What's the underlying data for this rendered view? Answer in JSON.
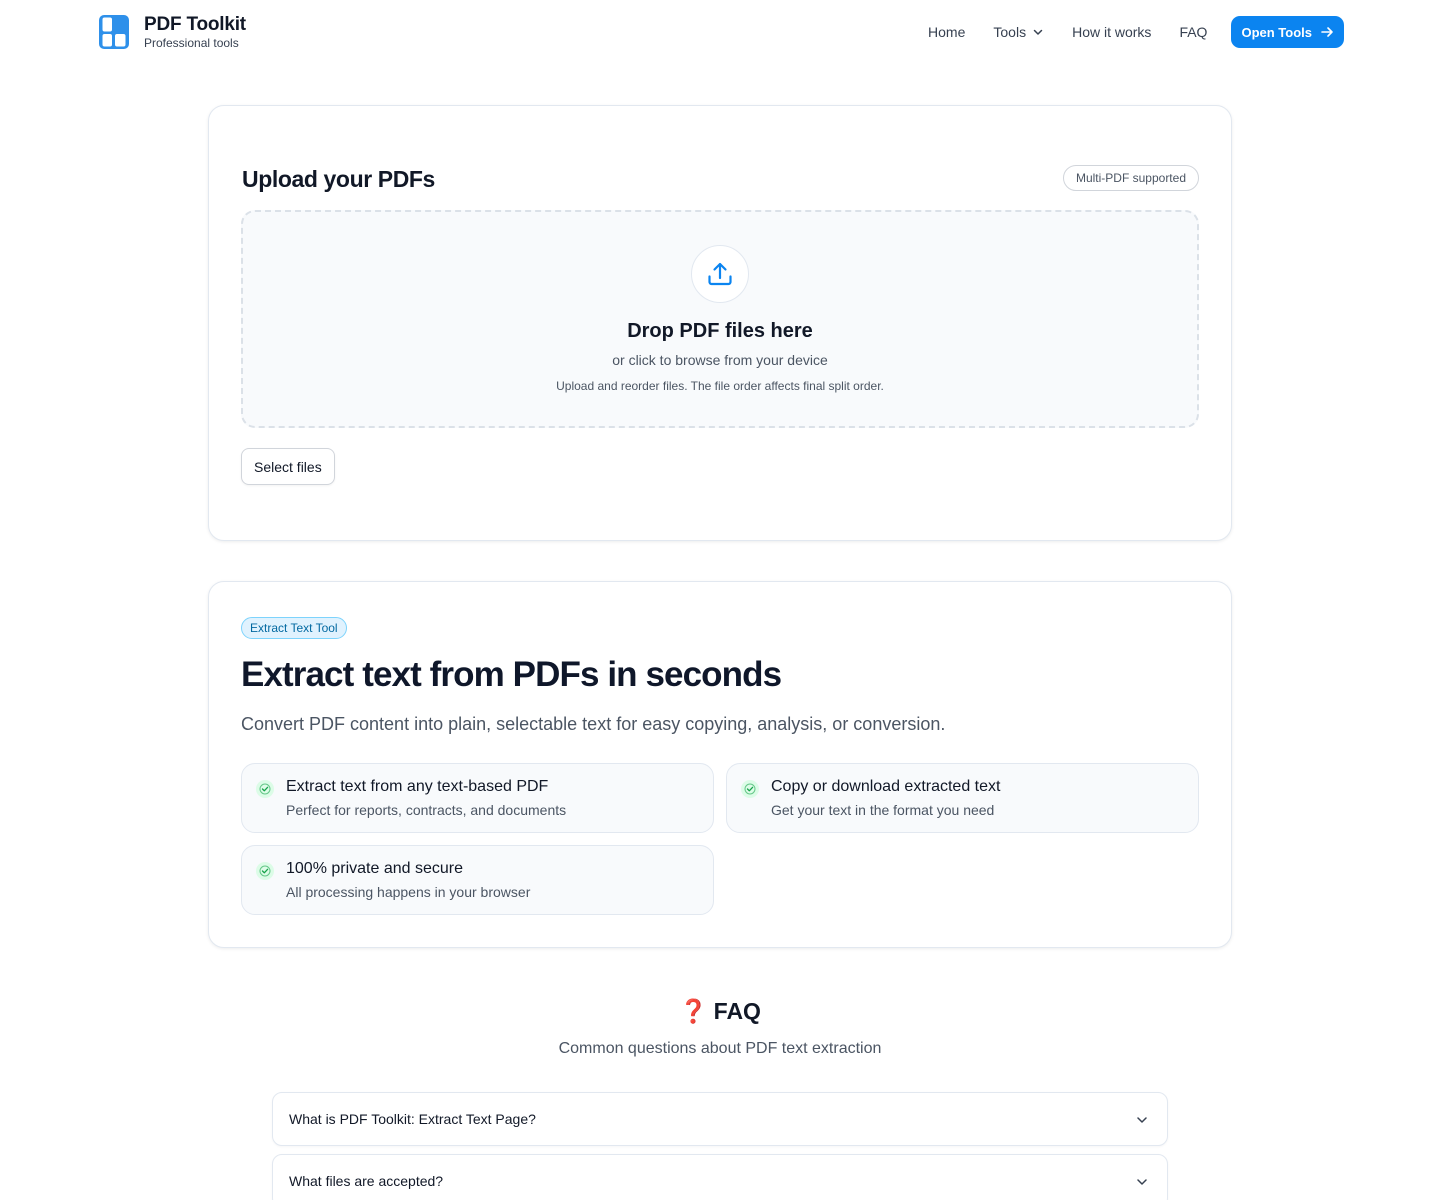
{
  "header": {
    "brand_name": "PDF Toolkit",
    "brand_sub": "Professional tools",
    "nav": [
      {
        "label": "Home"
      },
      {
        "label": "Tools"
      },
      {
        "label": "How it works"
      },
      {
        "label": "FAQ"
      }
    ],
    "cta_label": "Open Tools"
  },
  "upload": {
    "title": "Upload your PDFs",
    "badge": "Multi-PDF supported",
    "drop_title": "Drop PDF files here",
    "drop_sub": "or click to browse from your device",
    "drop_note": "Upload and reorder files. The file order affects final split order.",
    "select_label": "Select files"
  },
  "extract": {
    "badge": "Extract Text Tool",
    "title": "Extract text from PDFs in seconds",
    "description": "Convert PDF content into plain, selectable text for easy copying, analysis, or conversion.",
    "features": [
      {
        "title": "Extract text from any text-based PDF",
        "sub": "Perfect for reports, contracts, and documents"
      },
      {
        "title": "Copy or download extracted text",
        "sub": "Get your text in the format you need"
      },
      {
        "title": "100% private and secure",
        "sub": "All processing happens in your browser"
      }
    ]
  },
  "faq": {
    "icon": "❓",
    "title": "FAQ",
    "subtitle": "Common questions about PDF text extraction",
    "items": [
      {
        "question": "What is PDF Toolkit: Extract Text Page?"
      },
      {
        "question": "What files are accepted?"
      }
    ]
  },
  "colors": {
    "accent": "#0b84f0",
    "badge_bg": "#e0f2fe",
    "check_bg": "#dcfce7",
    "faq_icon": "#dc2626"
  }
}
